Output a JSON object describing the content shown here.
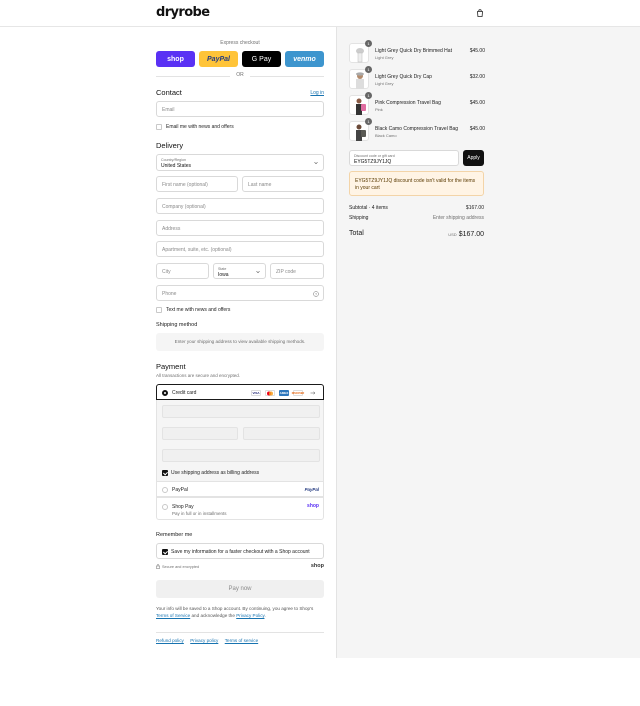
{
  "brand": {
    "name": "dryrobe"
  },
  "express": {
    "label": "Express checkout",
    "buttons": [
      {
        "label": "shop",
        "color": "#5a31f4"
      },
      {
        "label": "PayPal",
        "color": "#ffc439"
      },
      {
        "label": "G Pay",
        "color": "#000000"
      },
      {
        "label": "venmo",
        "color": "#3d95ce"
      }
    ],
    "or": "OR"
  },
  "contact": {
    "heading": "Contact",
    "login_link": "Log in",
    "email_placeholder": "Email",
    "newsletter_label": "Email me with news and offers"
  },
  "delivery": {
    "heading": "Delivery",
    "country_label": "Country/Region",
    "country_value": "United States",
    "first_name_placeholder": "First name (optional)",
    "last_name_placeholder": "Last name",
    "company_placeholder": "Company (optional)",
    "address_placeholder": "Address",
    "apartment_placeholder": "Apartment, suite, etc. (optional)",
    "city_placeholder": "City",
    "state_label": "State",
    "state_value": "Iowa",
    "zip_placeholder": "ZIP code",
    "phone_placeholder": "Phone",
    "sms_label": "Text me with news and offers"
  },
  "shipping_method": {
    "heading": "Shipping method",
    "notice": "Enter your shipping address to view available shipping methods."
  },
  "payment": {
    "heading": "Payment",
    "subtext": "All transactions are secure and encrypted.",
    "credit_card_label": "Credit card",
    "card_brands": [
      "VISA",
      "MC",
      "AMEX",
      "DISCOVER"
    ],
    "billing_label": "Use shipping address as billing address",
    "paypal_label": "PayPal",
    "paypal_logo": "PayPal",
    "shoppay_label": "Shop Pay",
    "shoppay_sub": "Pay in full or in installments",
    "shoppay_logo": "shop"
  },
  "remember": {
    "heading": "Remember me",
    "save_label": "Save my information for a faster checkout with a Shop account",
    "secure_text": "Secure and encrypted",
    "shop_logo": "shop"
  },
  "pay_now": "Pay now",
  "legal": {
    "text_before": "Your info will be saved to a Shop account. By continuing, you agree to Shop's",
    "terms_link": "Terms of Service",
    "middle": "and acknowledge the",
    "privacy_link": "Privacy Policy",
    "end": "."
  },
  "footer_links": [
    "Refund policy",
    "Privacy policy",
    "Terms of service"
  ],
  "order": {
    "items": [
      {
        "title": "Light Grey Quick Dry Brimmed Hat",
        "variant": "Light Grey",
        "price": "$45.00",
        "qty": "1"
      },
      {
        "title": "Light Grey Quick Dry Cap",
        "variant": "Light Grey",
        "price": "$32.00",
        "qty": "1"
      },
      {
        "title": "Pink Compression Travel Bag",
        "variant": "Pink",
        "price": "$45.00",
        "qty": "1"
      },
      {
        "title": "Black Camo Compression Travel Bag",
        "variant": "Black Camo",
        "price": "$45.00",
        "qty": "1"
      }
    ],
    "discount_label": "Discount code or gift card",
    "discount_value": "EYG5TZ9JY1JQ",
    "apply": "Apply",
    "warning": "EYG5TZ9JY1JQ discount code isn't valid for the items in your cart",
    "subtotal_label": "Subtotal · 4 items",
    "subtotal_value": "$167.00",
    "shipping_label": "Shipping",
    "shipping_value": "Enter shipping address",
    "total_label": "Total",
    "currency": "USD",
    "total_value": "$167.00"
  }
}
